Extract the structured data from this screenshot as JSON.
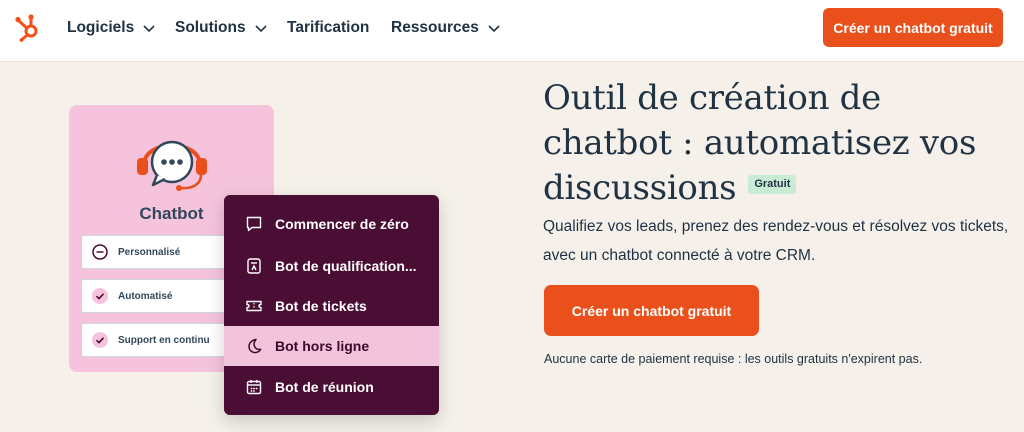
{
  "header": {
    "logo_icon": "hubspot-sprocket-icon",
    "nav": [
      {
        "label": "Logiciels",
        "has_dropdown": true
      },
      {
        "label": "Solutions",
        "has_dropdown": true
      },
      {
        "label": "Tarification",
        "has_dropdown": false
      },
      {
        "label": "Ressources",
        "has_dropdown": true
      }
    ],
    "cta_label": "Créer un chatbot gratuit"
  },
  "illustration": {
    "card_title": "Chatbot",
    "card_icon": "chat-headset-icon",
    "options": [
      {
        "label": "Personnalisé",
        "icon": "minus-circle-icon"
      },
      {
        "label": "Automatisé",
        "icon": "check-circle-icon"
      },
      {
        "label": "Support en continu",
        "icon": "check-circle-icon"
      }
    ],
    "menu": [
      {
        "label": "Commencer de zéro",
        "icon": "chat-square-icon"
      },
      {
        "label": "Bot de qualification...",
        "icon": "qualify-icon"
      },
      {
        "label": "Bot de tickets",
        "icon": "ticket-icon"
      },
      {
        "label": "Bot hors ligne",
        "icon": "moon-icon",
        "active": true
      },
      {
        "label": "Bot de réunion",
        "icon": "calendar-icon"
      }
    ]
  },
  "hero": {
    "headline": "Outil de création de chatbot : automatisez vos discussions",
    "badge": "Gratuit",
    "description": "Qualifiez vos leads, prenez des rendez-vous et résolvez vos tickets, avec un chatbot connecté à votre CRM.",
    "cta_label": "Créer un chatbot gratuit",
    "note": "Aucune carte de paiement requise : les outils gratuits n'expirent pas."
  },
  "colors": {
    "brand_orange": "#e9501c",
    "page_bg": "#f5f1ea",
    "card_pink": "#f5c4dc",
    "menu_plum": "#4a0d33",
    "badge_green": "#c9ecd5",
    "text_dark": "#213343"
  }
}
